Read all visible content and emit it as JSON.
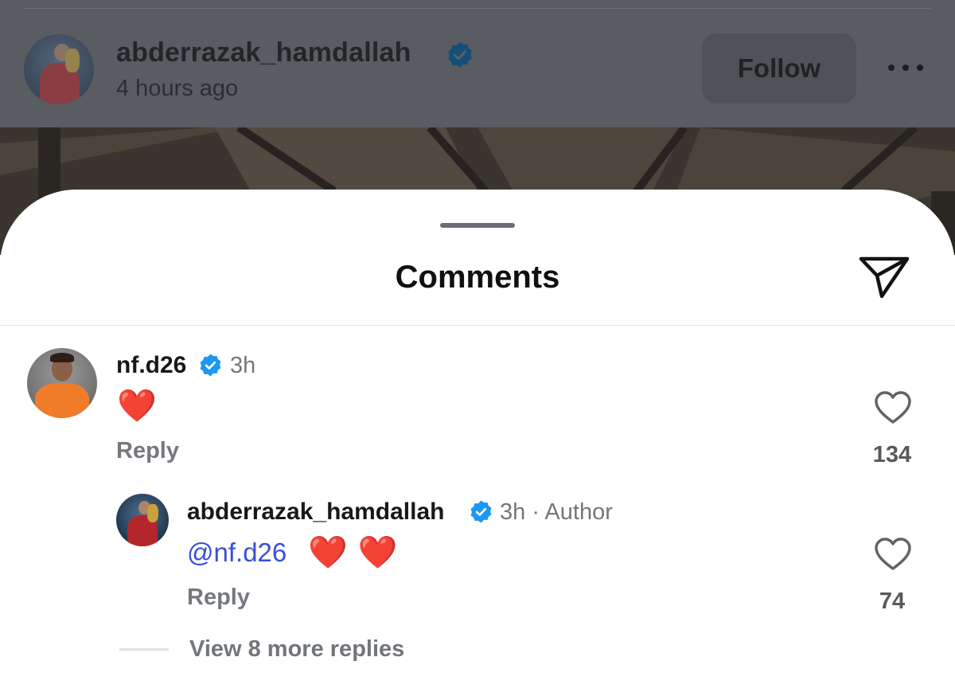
{
  "post": {
    "username": "abderrazak_hamdallah",
    "time": "4 hours ago",
    "follow_label": "Follow",
    "verified": true
  },
  "sheet": {
    "title": "Comments"
  },
  "comments": [
    {
      "username": "nf.d26",
      "verified": true,
      "time": "3h",
      "text": "❤️",
      "reply_label": "Reply",
      "likes": "134"
    }
  ],
  "reply": {
    "username": "abderrazak_hamdallah",
    "verified": true,
    "time_author": "3h · Author",
    "mention": "@nf.d26",
    "text": "❤️ ❤️",
    "reply_label": "Reply",
    "likes": "74"
  },
  "view_more": "View 8 more replies",
  "colors": {
    "verified_badge": "#1d98f0",
    "mention": "#3a4fd6",
    "heart": "#e0141e"
  }
}
